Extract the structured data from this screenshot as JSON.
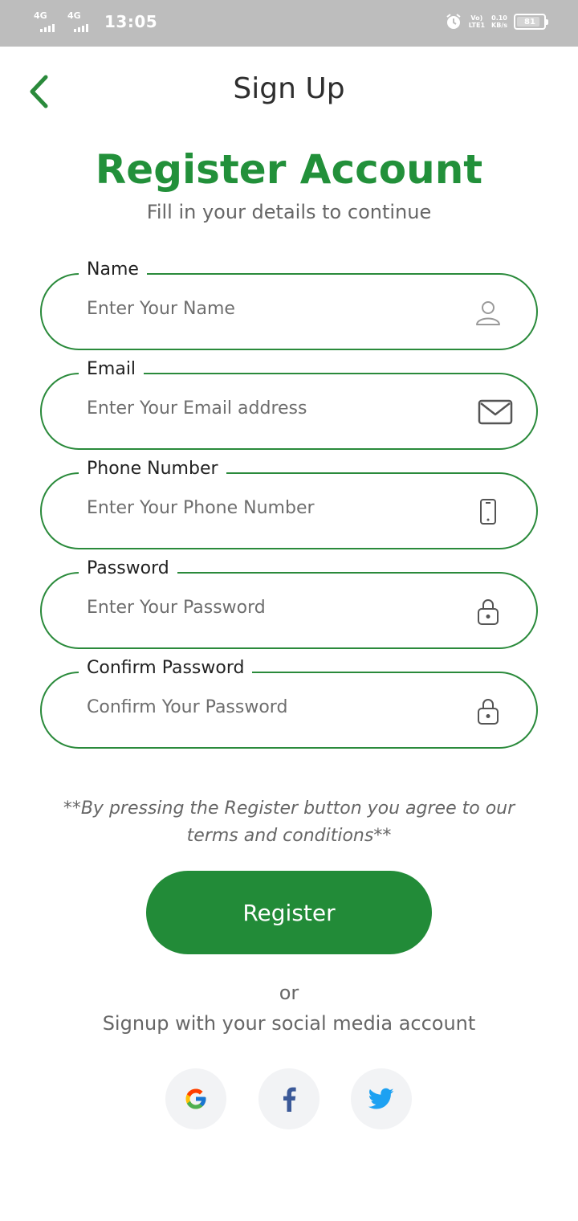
{
  "status_bar": {
    "network_1": "4G",
    "network_2": "4G",
    "time": "13:05",
    "volte": "Vo)",
    "lte": "LTE1",
    "speed_value": "0.10",
    "speed_unit": "KB/s",
    "battery": "81"
  },
  "header": {
    "title": "Sign Up",
    "back_icon": "chevron-left-icon"
  },
  "hero": {
    "title": "Register Account",
    "subtitle": "Fill in your details to continue"
  },
  "form": {
    "name": {
      "label": "Name",
      "placeholder": "Enter Your Name",
      "icon": "person-icon"
    },
    "email": {
      "label": "Email",
      "placeholder": "Enter Your Email address",
      "icon": "envelope-icon"
    },
    "phone": {
      "label": "Phone Number",
      "placeholder": "Enter Your Phone Number",
      "icon": "phone-icon"
    },
    "password": {
      "label": "Password",
      "placeholder": "Enter Your Password",
      "icon": "lock-icon"
    },
    "confirm_password": {
      "label": "Confirm Password",
      "placeholder": "Confirm Your Password",
      "icon": "lock-icon"
    }
  },
  "terms": {
    "line1": "**By pressing the Register button you agree to our",
    "line2": "terms and conditions**"
  },
  "register_button": "Register",
  "social": {
    "or": "or",
    "text": "Signup with your social media account",
    "providers": [
      "google-icon",
      "facebook-icon",
      "twitter-icon"
    ]
  },
  "colors": {
    "accent": "#22903a",
    "field_border": "#2a8a3b",
    "button": "#228b38",
    "status_bar": "#bdbdbd"
  }
}
